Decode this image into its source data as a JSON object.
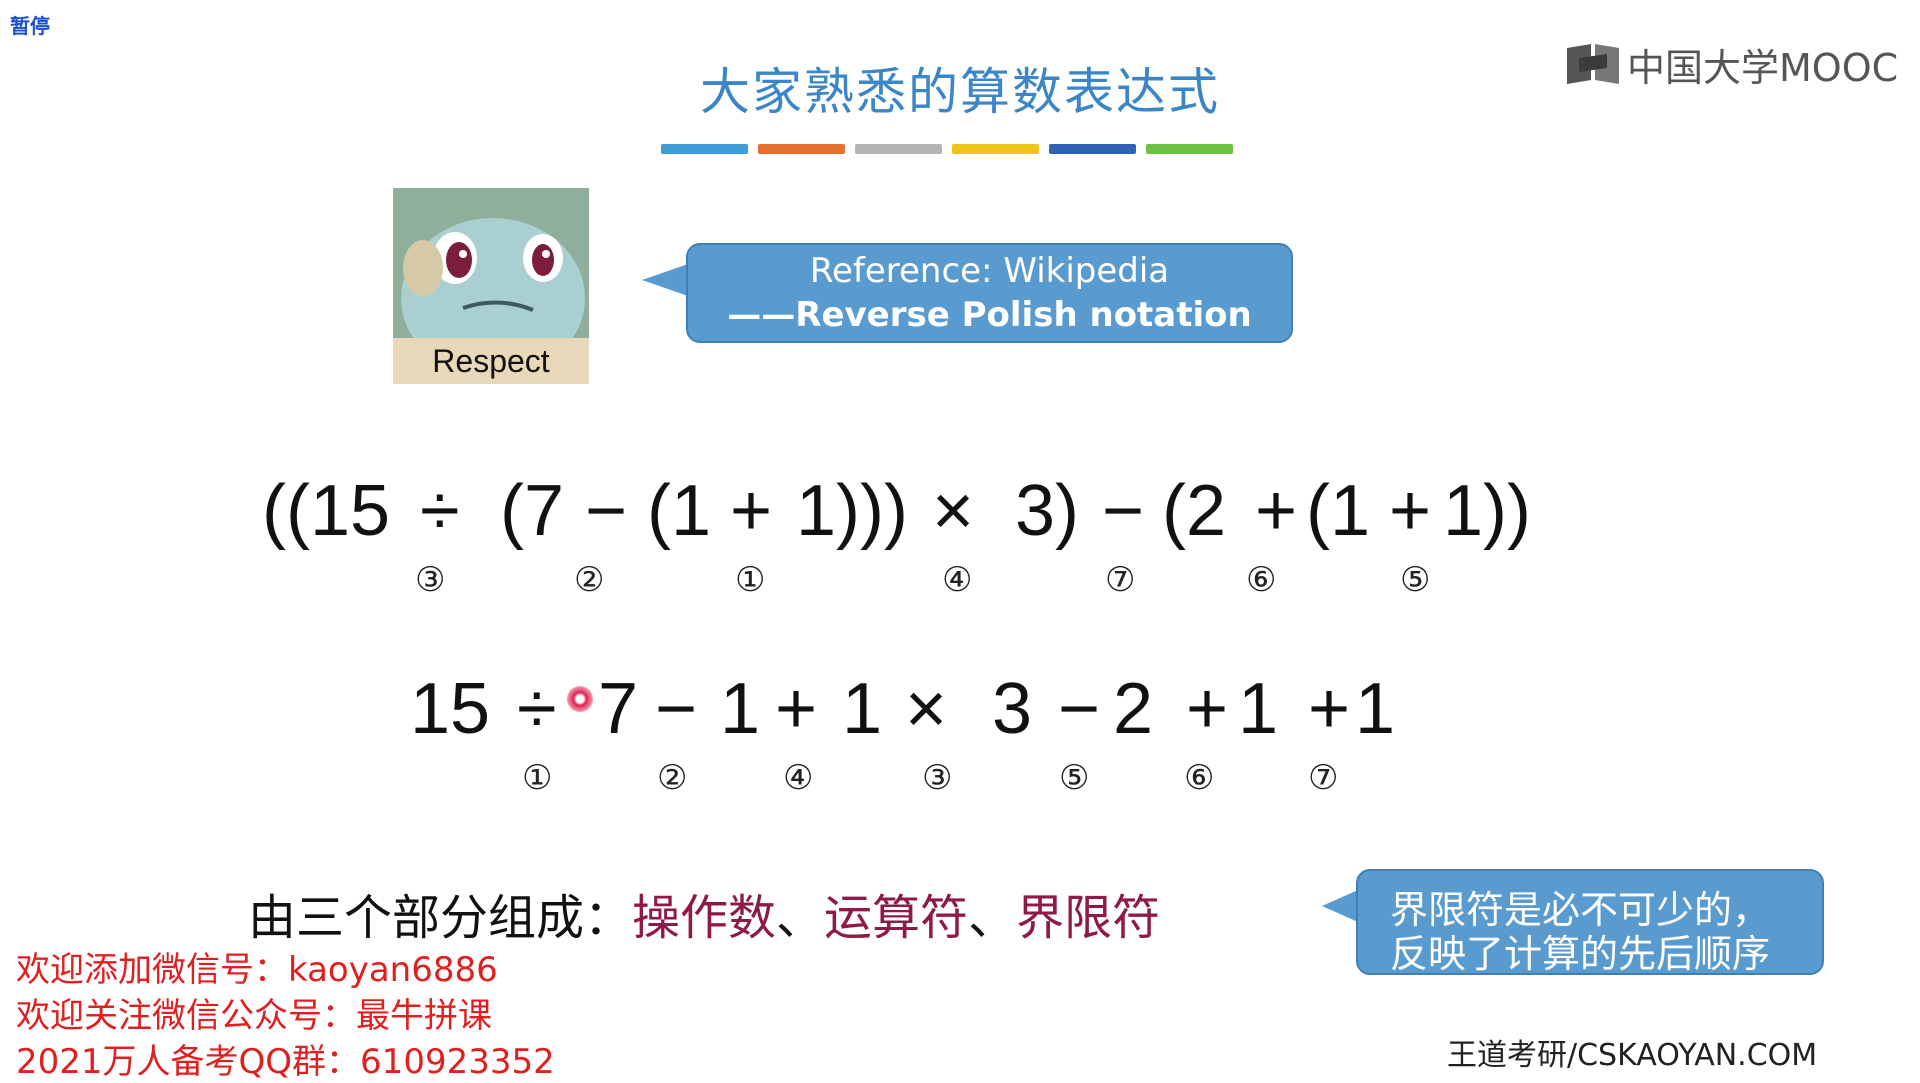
{
  "player": {
    "pause_label": "暂停"
  },
  "slide": {
    "title": "大家熟悉的算数表达式",
    "title_color": "#3a86c8",
    "color_bar": [
      "#3d9bd6",
      "#e3702e",
      "#b4b4b4",
      "#f0c21c",
      "#2f63b6",
      "#6cc140"
    ],
    "logo_text": "中国大学MOOC",
    "image_caption": "Respect",
    "reference": {
      "line1": "Reference: Wikipedia",
      "line2": "——Reverse Polish notation"
    },
    "expression_1": {
      "parts": [
        "((15",
        "÷",
        "(7",
        "−",
        "(1",
        "+",
        "1)))",
        "×",
        "3)",
        "−",
        "(2",
        "+",
        "(1",
        "+",
        "1))"
      ],
      "order_marks": [
        "③",
        "②",
        "①",
        "④",
        "⑦",
        "⑥",
        "⑤"
      ]
    },
    "expression_2": {
      "parts": [
        "15",
        "÷",
        "7",
        "−",
        "1",
        "+",
        "1",
        "×",
        "3",
        "−",
        "2",
        "+",
        "1",
        "+",
        "1"
      ],
      "order_marks": [
        "①",
        "②",
        "④",
        "③",
        "⑤",
        "⑥",
        "⑦"
      ]
    },
    "parts_line": {
      "prefix": "由三个部分组成：",
      "operand": "操作数",
      "sep1": "、",
      "operator": "运算符",
      "sep2": "、",
      "delimiter": "界限符",
      "highlight_color": "#8e1a4a"
    },
    "delimiter_note": {
      "line1": "界限符是必不可少的，",
      "line2": "反映了计算的先后顺序"
    },
    "watermarks": [
      "欢迎添加微信号：kaoyan6886",
      "欢迎关注微信公众号：最牛拼课",
      "2021万人备考QQ群：610923352"
    ],
    "footer": "王道考研/CSKAOYAN.COM"
  }
}
